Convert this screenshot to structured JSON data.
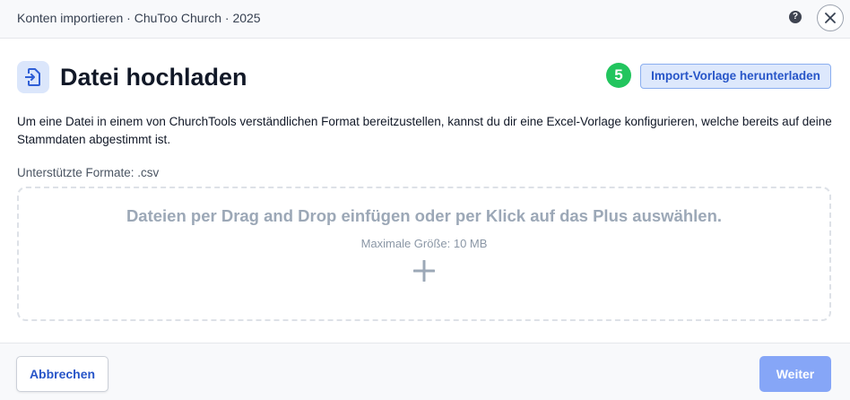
{
  "header": {
    "title": "Konten importieren · ChuToo Church · 2025",
    "help_icon": "question-circle-icon",
    "help_glyph": "?",
    "close_icon": "close-icon"
  },
  "main": {
    "upload_icon": "file-import-icon",
    "title": "Datei hochladen",
    "step_number": "5",
    "template_button_label": "Import-Vorlage herunterladen",
    "description": "Um eine Datei in einem von ChurchTools verständlichen Format bereitzustellen, kannst du dir eine Excel-Vorlage konfigurieren, welche bereits auf deine Stammdaten abgestimmt ist.",
    "formats_label": "Unterstützte Formate: .csv",
    "dropzone": {
      "text": "Dateien per Drag and Drop einfügen oder per Klick auf das Plus auswählen.",
      "max_size": "Maximale Größe: 10 MB",
      "add_icon": "plus-icon"
    }
  },
  "footer": {
    "cancel_label": "Abbrechen",
    "next_label": "Weiter"
  },
  "colors": {
    "accent": "#2755c8",
    "step_badge": "#22c55e",
    "next_button_disabled": "#86a6f7"
  }
}
